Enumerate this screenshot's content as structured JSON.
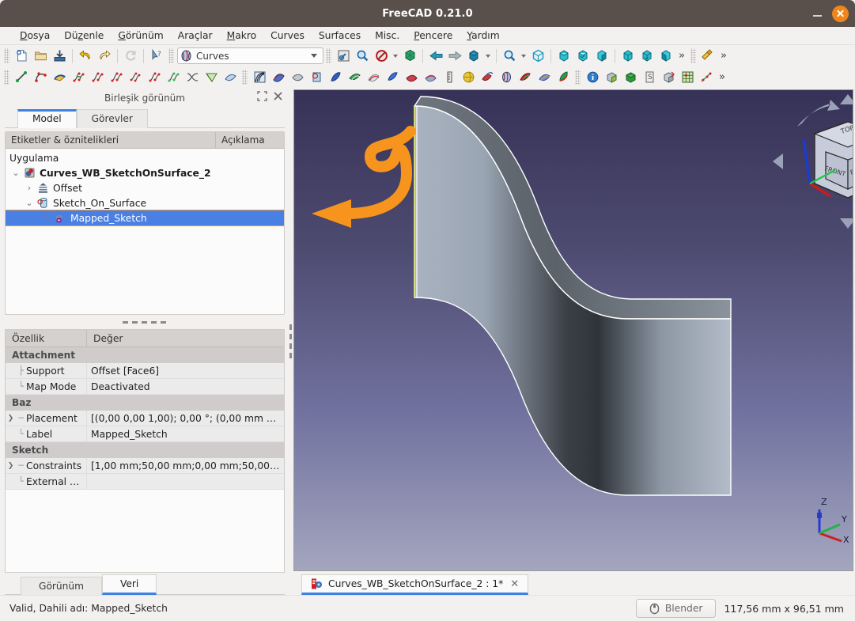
{
  "window": {
    "title": "FreeCAD 0.21.0",
    "minimize_label": "−",
    "close_label": "×",
    "accent_close": "#f0861a"
  },
  "menubar": [
    {
      "label": "Dosya",
      "mnemonic": "D"
    },
    {
      "label": "Düzenle",
      "mnemonic": "z"
    },
    {
      "label": "Görünüm",
      "mnemonic": "G"
    },
    {
      "label": "Araçlar",
      "mnemonic": ""
    },
    {
      "label": "Makro",
      "mnemonic": "M"
    },
    {
      "label": "Curves",
      "mnemonic": ""
    },
    {
      "label": "Surfaces",
      "mnemonic": ""
    },
    {
      "label": "Misc.",
      "mnemonic": ""
    },
    {
      "label": "Pencere",
      "mnemonic": "P"
    },
    {
      "label": "Yardım",
      "mnemonic": "Y"
    }
  ],
  "workbench": {
    "selected": "Curves",
    "icon": "curves-workbench-icon"
  },
  "toolbar_file": [
    {
      "icon": "new-document-icon"
    },
    {
      "icon": "open-folder-icon"
    },
    {
      "icon": "save-icon"
    },
    {
      "icon": "undo-icon"
    },
    {
      "icon": "redo-icon"
    },
    {
      "icon": "refresh-icon"
    },
    {
      "icon": "whats-this-icon"
    }
  ],
  "toolbar_view": [
    {
      "icon": "fit-all-icon"
    },
    {
      "icon": "fit-selection-icon"
    },
    {
      "icon": "draw-style-icon"
    },
    {
      "icon": "axis-cross-icon"
    },
    {
      "icon": "back-arrow-icon"
    },
    {
      "icon": "forward-arrow-icon"
    },
    {
      "icon": "std-views-icon"
    },
    {
      "icon": "zoom-icon"
    },
    {
      "icon": "isometric-icon"
    },
    {
      "icon": "front-view-icon"
    },
    {
      "icon": "top-view-icon"
    },
    {
      "icon": "right-view-icon"
    },
    {
      "icon": "rear-view-icon"
    },
    {
      "icon": "bottom-view-icon"
    },
    {
      "icon": "left-view-icon"
    },
    {
      "icon": "measure-icon"
    }
  ],
  "toolbar_curves": [
    {
      "icon": "line-icon"
    },
    {
      "icon": "bezier-curve-icon"
    },
    {
      "icon": "editable-spline-icon"
    },
    {
      "icon": "join-curve-icon"
    },
    {
      "icon": "split-curve-icon"
    },
    {
      "icon": "discretize-icon"
    },
    {
      "icon": "approximate-icon"
    },
    {
      "icon": "interpolate-icon"
    },
    {
      "icon": "parametric-curve-icon"
    },
    {
      "icon": "blend-curve-icon"
    },
    {
      "icon": "curve-on-surface-icon"
    },
    {
      "icon": "isocurve-icon"
    },
    {
      "icon": "zebra-icon"
    },
    {
      "icon": "surface-analysis-icon"
    },
    {
      "icon": "gordon-surface-icon"
    },
    {
      "icon": "sketch-on-surface-icon"
    },
    {
      "icon": "pipeshell-icon"
    },
    {
      "icon": "flatten-face-icon"
    },
    {
      "icon": "profile-support-icon"
    },
    {
      "icon": "sweep-icon"
    },
    {
      "icon": "segment-surface-icon"
    },
    {
      "icon": "extend-face-icon"
    },
    {
      "icon": "multi-loft-icon"
    },
    {
      "icon": "ruler-icon"
    },
    {
      "icon": "sphere-icon"
    },
    {
      "icon": "solid-from-shell-icon"
    },
    {
      "icon": "mixed-curve-icon"
    },
    {
      "icon": "paste-icon"
    },
    {
      "icon": "blend-surface-icon"
    },
    {
      "icon": "trim-face-icon"
    },
    {
      "icon": "info-icon"
    },
    {
      "icon": "compound-icon"
    },
    {
      "icon": "compound-filter-icon"
    },
    {
      "icon": "sketch-tool-icon"
    },
    {
      "icon": "solid-icon"
    },
    {
      "icon": "grid-icon"
    },
    {
      "icon": "point-cloud-icon"
    }
  ],
  "dock": {
    "title": "Birleşik görünüm",
    "float_icon": "restore-icon",
    "close_icon": "close-icon",
    "tabs": [
      {
        "label": "Model",
        "active": true
      },
      {
        "label": "Görevler",
        "active": false
      }
    ]
  },
  "tree": {
    "columns": [
      "Etiketler & öznitelikleri",
      "Açıklama"
    ],
    "root_label": "Uygulama",
    "items": [
      {
        "label": "Curves_WB_SketchOnSurface_2",
        "icon": "document-icon",
        "depth": 1,
        "expanded": true,
        "bold": true,
        "selected": false,
        "has_twist": true
      },
      {
        "label": "Offset",
        "icon": "offset-icon",
        "depth": 2,
        "expanded": false,
        "bold": false,
        "selected": false,
        "has_twist": true
      },
      {
        "label": "Sketch_On_Surface",
        "icon": "sketch-on-surface-icon",
        "depth": 2,
        "expanded": true,
        "bold": false,
        "selected": false,
        "has_twist": true
      },
      {
        "label": "Mapped_Sketch",
        "icon": "mapped-sketch-icon",
        "depth": 3,
        "expanded": false,
        "bold": false,
        "selected": true,
        "has_twist": false
      }
    ],
    "selection_highlight": "#4a7fe3",
    "annotation_outline": "#f59a22"
  },
  "properties": {
    "columns": [
      "Özellik",
      "Değer"
    ],
    "rows": [
      {
        "type": "group",
        "name": "Attachment"
      },
      {
        "type": "row",
        "name": "Support",
        "value": "Offset [Face6]",
        "expandable": false
      },
      {
        "type": "row",
        "name": "Map Mode",
        "value": "Deactivated",
        "expandable": false,
        "last": true
      },
      {
        "type": "group",
        "name": "Baz"
      },
      {
        "type": "row",
        "name": "Placement",
        "value": "[(0,00 0,00 1,00); 0,00 °; (0,00 mm  …",
        "expandable": true
      },
      {
        "type": "row",
        "name": "Label",
        "value": "Mapped_Sketch",
        "expandable": false,
        "last": true
      },
      {
        "type": "group",
        "name": "Sketch"
      },
      {
        "type": "row",
        "name": "Constraints",
        "value": "[1,00 mm;50,00 mm;0,00 mm;50,00…",
        "expandable": true
      },
      {
        "type": "row",
        "name": "External …",
        "value": "",
        "expandable": false,
        "last": true
      }
    ]
  },
  "bottom_tabs": [
    {
      "label": "Görünüm",
      "active": false
    },
    {
      "label": "Veri",
      "active": true
    }
  ],
  "document_tab": {
    "label": "Curves_WB_SketchOnSurface_2 : 1*",
    "icon": "freecad-doc-icon",
    "close_label": "✕"
  },
  "statusbar": {
    "message": "Valid, Dahili adı: Mapped_Sketch",
    "nav_style": "Blender",
    "nav_icon": "mouse-icon",
    "dimensions": "117,56 mm x 96,51 mm"
  },
  "viewport": {
    "background_top": "#363157",
    "background_bottom": "#a4a6bf",
    "navcube": {
      "faces": [
        "TOP",
        "FRONT",
        "RIGHT"
      ]
    },
    "axis_labels": [
      "Z",
      "Y",
      "X"
    ],
    "annotation": {
      "type": "curly-arrow",
      "color": "#f7941e",
      "points_to": "Mapped_Sketch"
    }
  }
}
